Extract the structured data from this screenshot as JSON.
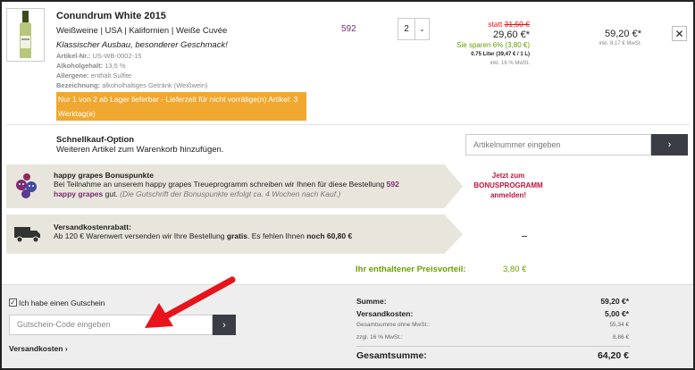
{
  "product": {
    "title": "Conundrum White 2015",
    "categories": "Weißweine | USA | Kalifornien | Weiße Cuvée",
    "description": "Klassischer Ausbau, besonderer Geschmack!",
    "meta": [
      {
        "label": "Artikel-Nr.:",
        "value": "US-WB-0002-15"
      },
      {
        "label": "Alkoholgehalt:",
        "value": "13,5 %"
      },
      {
        "label": "Allergene:",
        "value": "enthält Sulfite"
      },
      {
        "label": "Bezeichnung:",
        "value": "alkoholhaltiges Getränk (Weißwein)"
      }
    ],
    "stock_notice": "Nur 1 von 2 ab Lager lieferbar - Lieferzeit für nicht vorrätige(n) Artikel: 3 Werktag(e)",
    "points": "592",
    "quantity": "2",
    "statt_label": "statt",
    "old_price": "31,50 €",
    "price": "29,60 €*",
    "savings": "Sie sparen 6% (3,80 €)",
    "liter_price": "0.75 Liter (39,47 € / 1 L)",
    "tax": "inkl. 16 % MwSt.",
    "total": "59,20 €*",
    "total_tax": "inkl. 8,17 € MwSt.",
    "remove_icon": "close-icon"
  },
  "quick_buy": {
    "title": "Schnellkauf-Option",
    "subtitle": "Weiteren Artikel zum Warenkorb hinzufügen.",
    "placeholder": "Artikelnummer eingeben",
    "go": "›"
  },
  "bonus": {
    "title": "happy grapes Bonuspunkte",
    "text_1": "Bei Teilnahme an unserem happy grapes Treueprogramm schreiben wir Ihnen für diese Bestellung ",
    "points": "592 happy grapes",
    "text_2": " gut. ",
    "note": "(Die Gutschrift der Bonuspunkte erfolgt ca. 4 Wochen nach Kauf.)",
    "join_l1": "Jetzt zum",
    "join_l2": "BONUSPROGRAMM",
    "join_l3": "anmelden!"
  },
  "shipping": {
    "title": "Versandkostenrabatt:",
    "text_1": "Ab 120 € Warenwert versenden wir Ihre Bestellung ",
    "gratis": "gratis",
    "text_2": ". Es fehlen Ihnen ",
    "missing": "noch 60,80 €",
    "dash": "--"
  },
  "advantage": {
    "label": "Ihr enthaltener Preisvorteil:",
    "value": "3,80 €"
  },
  "voucher": {
    "checkbox_label": "Ich habe einen Gutschein",
    "placeholder": "Gutschein-Code eingeben",
    "go": "›",
    "shipping_link": "Versandkosten ›"
  },
  "summary": {
    "sum_label": "Summe:",
    "sum_value": "59,20 €*",
    "ship_label": "Versandkosten:",
    "ship_value": "5,00 €*",
    "net_label": "Gesamtsumme ohne MwSt.:",
    "net_value": "55,34 €",
    "vat_label": "zzgl. 16 % MwSt.:",
    "vat_value": "8,86 €",
    "total_label": "Gesamtsumme:",
    "total_value": "64,20 €"
  }
}
